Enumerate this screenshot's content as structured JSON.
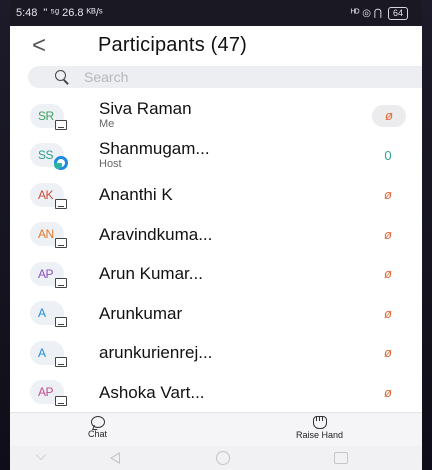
{
  "status_bar": {
    "time": "5:48",
    "signal_text": "\" ⁵ᵍ 26.8 ᴷᴮ/ˢ",
    "right_text": "ᴴᴰ ◎ ⋂",
    "battery": "64"
  },
  "header": {
    "back_glyph": "<",
    "title": "Participants (47)"
  },
  "search": {
    "placeholder": "Search"
  },
  "participants": [
    {
      "initials": "SR",
      "initials_color": "#3e9f5e",
      "name": "Siva Raman",
      "role": "Me",
      "badge": "device-icon",
      "mic": "muted",
      "mic_boxed": true
    },
    {
      "initials": "SS",
      "initials_color": "#2e9e8a",
      "name": "Shanmugam...",
      "role": "Host",
      "badge": "host-icon",
      "mic": "unmuted",
      "mic_boxed": false
    },
    {
      "initials": "AK",
      "initials_color": "#d24b3b",
      "name": "Ananthi K",
      "role": "",
      "badge": "device-icon",
      "mic": "muted",
      "mic_boxed": false
    },
    {
      "initials": "AN",
      "initials_color": "#e07a2c",
      "name": "Aravindkuma...",
      "role": "",
      "badge": "device-icon",
      "mic": "muted",
      "mic_boxed": false
    },
    {
      "initials": "AP",
      "initials_color": "#8a4fc2",
      "name": "Arun Kumar...",
      "role": "",
      "badge": "device-icon",
      "mic": "muted",
      "mic_boxed": false
    },
    {
      "initials": "A",
      "initials_color": "#1f8fd8",
      "name": "Arunkumar",
      "role": "",
      "badge": "device-icon",
      "mic": "muted",
      "mic_boxed": false
    },
    {
      "initials": "A",
      "initials_color": "#1f8fd8",
      "name": "arunkurienrej...",
      "role": "",
      "badge": "device-icon",
      "mic": "muted",
      "mic_boxed": false
    },
    {
      "initials": "AP",
      "initials_color": "#c24f8a",
      "name": "Ashoka Vart...",
      "role": "",
      "badge": "device-icon",
      "mic": "muted",
      "mic_boxed": false
    }
  ],
  "mic_glyphs": {
    "muted": "ø",
    "unmuted": "0"
  },
  "footer": {
    "chat_label": "Chat",
    "raise_hand_label": "Raise Hand"
  },
  "colors": {
    "muted_mic": "#e06a3c",
    "unmuted_mic": "#2ca58d",
    "host_ring": "#1e88e5"
  }
}
